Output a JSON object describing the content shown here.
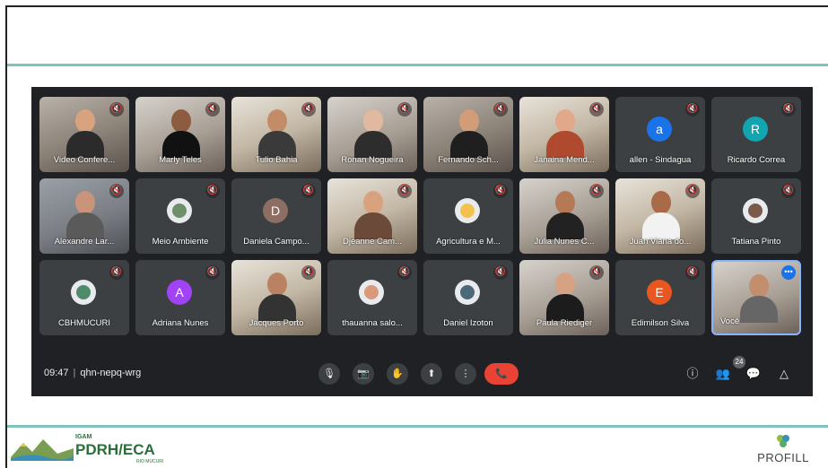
{
  "meeting": {
    "time": "09:47",
    "code": "qhn-nepq-wrg",
    "participant_count": "24"
  },
  "participants": [
    {
      "name": "Video Confere...",
      "type": "video"
    },
    {
      "name": "Marly Teles",
      "type": "video"
    },
    {
      "name": "Tulio Bahia",
      "type": "video"
    },
    {
      "name": "Ronan Nogueira",
      "type": "video"
    },
    {
      "name": "Fernando Sch...",
      "type": "video"
    },
    {
      "name": "Janaina Mend...",
      "type": "video"
    },
    {
      "name": "allen - Sindagua",
      "type": "letter",
      "letter": "a",
      "color": "#1a73e8"
    },
    {
      "name": "Ricardo Correa",
      "type": "letter",
      "letter": "R",
      "color": "#12a4af"
    },
    {
      "name": "Alexandre Lar...",
      "type": "video"
    },
    {
      "name": "Meio Ambiente",
      "type": "image"
    },
    {
      "name": "Daniela Campo...",
      "type": "letter",
      "letter": "D",
      "color": "#8d6e63"
    },
    {
      "name": "Djeanne Cam...",
      "type": "video"
    },
    {
      "name": "Agricultura e M...",
      "type": "image"
    },
    {
      "name": "Júlia Nunes C...",
      "type": "video"
    },
    {
      "name": "Juan Viana do...",
      "type": "video"
    },
    {
      "name": "Tatiana Pinto",
      "type": "image"
    },
    {
      "name": "CBHMUCURI",
      "type": "image"
    },
    {
      "name": "Adriana Nunes",
      "type": "letter",
      "letter": "A",
      "color": "#a142f4"
    },
    {
      "name": "Jacques Porto",
      "type": "video"
    },
    {
      "name": "thauanna salo...",
      "type": "image"
    },
    {
      "name": "Daniel Izoton",
      "type": "image"
    },
    {
      "name": "Paula Riediger",
      "type": "video"
    },
    {
      "name": "Edimilson Silva",
      "type": "letter",
      "letter": "E",
      "color": "#e8571f"
    },
    {
      "name": "Você",
      "type": "video"
    }
  ],
  "icons": {
    "mute": "🔇",
    "mic": "🎙",
    "camera": "📷",
    "hand": "✋",
    "present": "⬆",
    "more": "⋮",
    "leave": "📞",
    "info": "ⓘ",
    "people": "👥",
    "chat": "💬",
    "activities": "△"
  },
  "branding": {
    "left_small": "IGAM",
    "left_big": "PDRH/ECA",
    "left_sub": "RIO MUCURI",
    "right": "PROFILL"
  },
  "colors": {
    "teal": "#7ec4bd",
    "meet_bg": "#202124",
    "tile_bg": "#3c4043",
    "leave_red": "#ea4335"
  }
}
